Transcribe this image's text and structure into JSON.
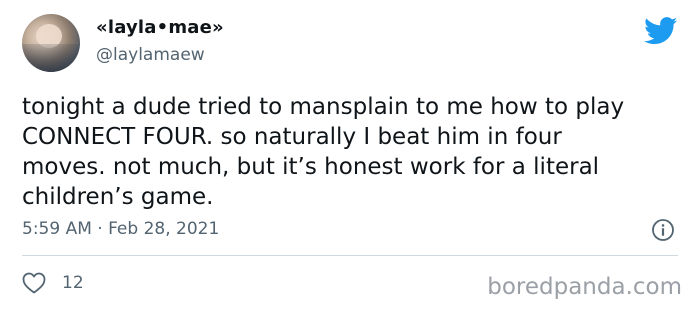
{
  "author": {
    "display_name": "«layla•mae»",
    "handle": "@laylamaew",
    "avatar_icon": "user-avatar"
  },
  "tweet": {
    "text": "tonight a dude tried to mansplain to me how to play\nCONNECT FOUR. so naturally I beat him in four\nmoves. not much, but it’s honest work for a literal\nchildren’s game.",
    "timestamp": "5:59 AM · Feb 28, 2021"
  },
  "actions": {
    "like_icon": "heart-outline-icon",
    "like_count": "12",
    "info_icon": "info-icon"
  },
  "brand": {
    "icon": "twitter-bird-icon",
    "color": "#1d9bf0"
  },
  "watermark": "boredpanda.com"
}
